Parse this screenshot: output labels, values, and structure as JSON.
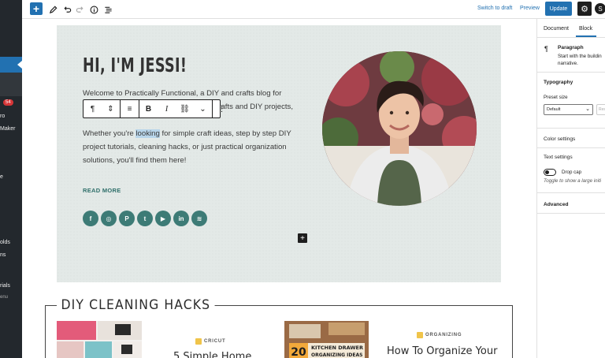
{
  "admin_sidebar": {
    "items": [
      "ro",
      "Maker",
      "e",
      "olds",
      "ns",
      "rials",
      "enu"
    ],
    "badge": "54"
  },
  "toolbar": {
    "inserter_icon": "plus-icon",
    "switch_to_draft": "Switch to draft",
    "preview": "Preview",
    "update": "Update",
    "accent_color": "#2271b1"
  },
  "hero": {
    "title": "HI, I'M JESSI!",
    "para1_line1": "Welcome to Practically Functional, a DIY and crafts blog for",
    "para1_line2": "everyone! I believe that anyone can do crafts and DIY projects,",
    "para2_before": "Whether you're ",
    "para2_highlight": "looking",
    "para2_after": " for simple craft ideas, step by step DIY project tutorials, cleaning hacks, or just practical organization solutions, you'll find them here!",
    "read_more": "READ MORE",
    "socials": [
      "f",
      "◎",
      "P",
      "t",
      "▶",
      "in",
      "≋"
    ],
    "background_color": "#e3e9e7",
    "social_color": "#3d7b76"
  },
  "block_toolbar": {
    "paragraph_icon": "¶",
    "move_icon": "⇕",
    "align_icon": "≡",
    "bold": "B",
    "italic": "I",
    "link_icon": "⛓",
    "more_icon": "⌄",
    "options_icon": "⋮"
  },
  "add_block": "+",
  "hacks": {
    "heading": "DIY CLEANING HACKS",
    "post1_category": "CRICUT",
    "post1_title": "5 Simple Home",
    "post2_category": "ORGANIZING",
    "post2_title": "How To Organize Your",
    "thumb2_text1": "20",
    "thumb2_text2": "KITCHEN DRAWER",
    "thumb2_text3": "ORGANIZING IDEAS"
  },
  "settings_panel": {
    "tab_document": "Document",
    "tab_block": "Block",
    "block_name": "Paragraph",
    "block_desc_line1": "Start with the buildin",
    "block_desc_line2": "narrative.",
    "typography": "Typography",
    "preset_size_label": "Preset size",
    "preset_size_value": "Default",
    "reset": "Res",
    "color_settings": "Color settings",
    "text_settings": "Text settings",
    "drop_cap": "Drop cap",
    "drop_cap_help": "Toggle to show a large initi",
    "advanced": "Advanced"
  }
}
